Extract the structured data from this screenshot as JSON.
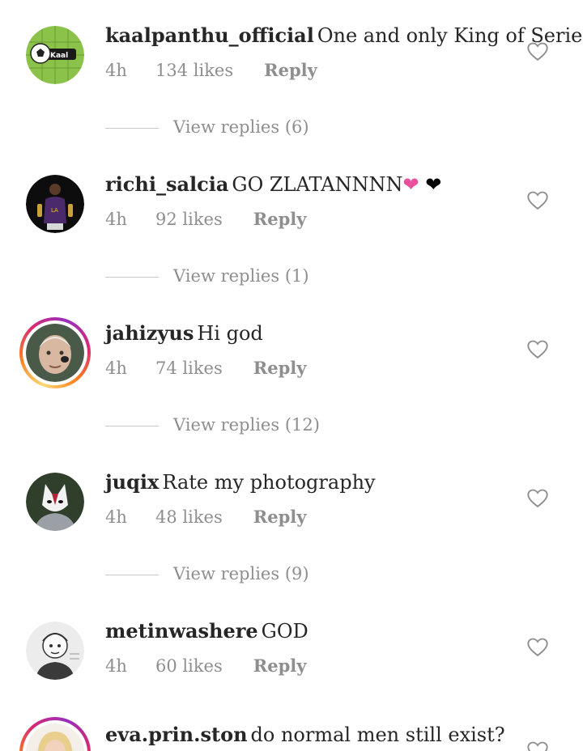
{
  "comments": [
    {
      "username": "kaalpanthu_official",
      "text": "One and only King of Serie A",
      "time": "4h",
      "likes": "134 likes",
      "reply": "Reply",
      "view_replies": "View replies (6)",
      "has_story": false,
      "avatar": "soccer-ball-logo-avatar"
    },
    {
      "username": "richi_salcia",
      "text": "GO ZLATANNNN",
      "emoji_pink": "❤",
      "emoji_black": "❤",
      "time": "4h",
      "likes": "92 likes",
      "reply": "Reply",
      "view_replies": "View replies (1)",
      "has_story": false,
      "avatar": "basketball-player-avatar"
    },
    {
      "username": "jahizyus",
      "text": "Hi god",
      "time": "4h",
      "likes": "74 likes",
      "reply": "Reply",
      "view_replies": "View replies (12)",
      "has_story": true,
      "avatar": "man-face-avatar"
    },
    {
      "username": "juqix",
      "text": "Rate my photography",
      "time": "4h",
      "likes": "48 likes",
      "reply": "Reply",
      "view_replies": "View replies (9)",
      "has_story": false,
      "avatar": "masked-character-avatar"
    },
    {
      "username": "metinwashere",
      "text": "GOD",
      "time": "4h",
      "likes": "60 likes",
      "reply": "Reply",
      "has_story": false,
      "avatar": "sketch-drawing-avatar"
    },
    {
      "username": "eva.prin.ston",
      "text": "do normal men still exist?",
      "has_story": true,
      "avatar": "blonde-woman-avatar"
    }
  ],
  "colors": {
    "text": "#262626",
    "muted": "#8e8e8e",
    "divider": "#c7c7c7",
    "pink_heart": "#e8509b"
  },
  "icons": {
    "like": "heart-outline-icon"
  }
}
